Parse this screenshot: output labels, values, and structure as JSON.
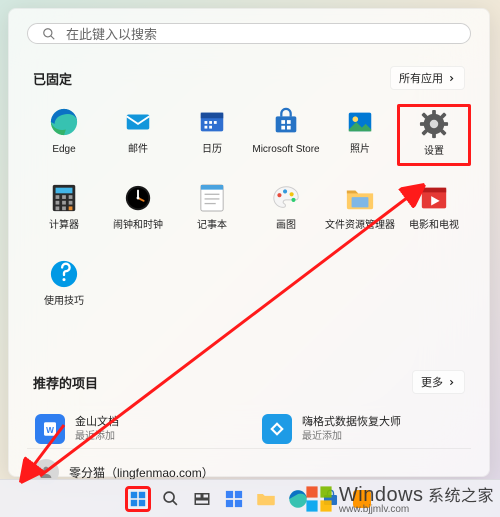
{
  "search": {
    "placeholder": "在此键入以搜索"
  },
  "pinned": {
    "title": "已固定",
    "all_apps_label": "所有应用",
    "apps": [
      {
        "label": "Edge"
      },
      {
        "label": "邮件"
      },
      {
        "label": "日历"
      },
      {
        "label": "Microsoft Store"
      },
      {
        "label": "照片"
      },
      {
        "label": "设置"
      },
      {
        "label": "计算器"
      },
      {
        "label": "闹钟和时钟"
      },
      {
        "label": "记事本"
      },
      {
        "label": "画图"
      },
      {
        "label": "文件资源管理器"
      },
      {
        "label": "电影和电视"
      },
      {
        "label": "使用技巧"
      }
    ]
  },
  "recommended": {
    "title": "推荐的项目",
    "more_label": "更多",
    "items": [
      {
        "title": "金山文档",
        "subtitle": "最近添加"
      },
      {
        "title": "嗨格式数据恢复大师",
        "subtitle": "最近添加"
      }
    ]
  },
  "user": {
    "display": "零分猫（lingfenmao.com）"
  },
  "colors": {
    "highlight": "#ff1a1a",
    "edge": "#1e88d2",
    "mail": "#1296db",
    "calendar": "#2f6fd0",
    "store": "#2673c5",
    "photos": "#0078d4",
    "settings": "#5a5a5a",
    "calc": "#2b2b2b",
    "clock": "#1a1a1a",
    "notepad": "#ffffff",
    "paint": "#f5f5f5",
    "explorer": "#ffcc66",
    "movies": "#e53935",
    "tips": "#0099e5"
  },
  "watermark": {
    "brand": "Windows",
    "sub": "系统之家",
    "url": "www.bjjmlv.com"
  }
}
